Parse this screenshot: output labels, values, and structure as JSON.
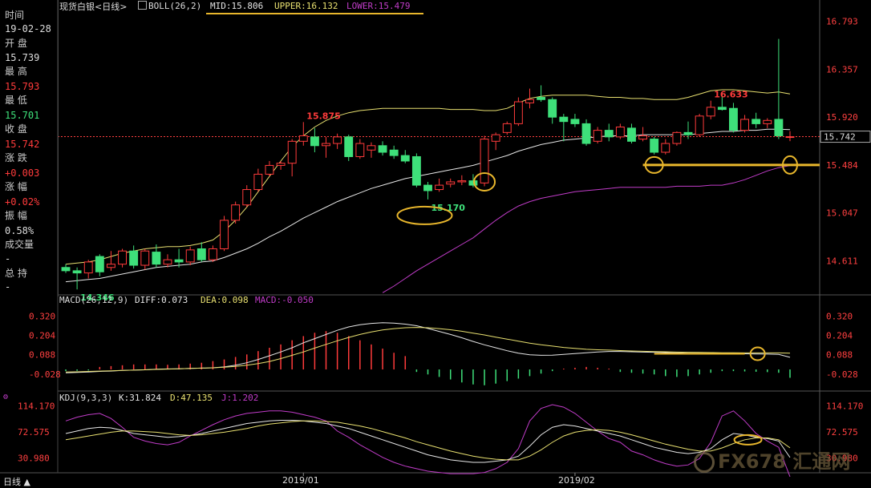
{
  "info_panel": {
    "labels": [
      "时间",
      "开 盘",
      "最 高",
      "最 低",
      "收 盘",
      "涨 跌",
      "涨 幅",
      "振 幅",
      "成交量",
      "总 持"
    ],
    "date": "19-02-28",
    "open": "15.739",
    "high": "15.793",
    "low": "15.701",
    "close": "15.742",
    "change": "+0.003",
    "change_pct": "+0.02%",
    "amplitude": "0.58%",
    "volume": "-",
    "open_interest": "-"
  },
  "main_header": {
    "instrument": "现货白银<日线>",
    "boll_label": "BOLL(26,2)",
    "mid": "MID:15.806",
    "upper": "UPPER:16.132",
    "lower": "LOWER:15.479"
  },
  "macd_header": {
    "label": "MACD(26,12,9)",
    "diff": "DIFF:0.073",
    "dea": "DEA:0.098",
    "macd": "MACD:-0.050"
  },
  "kdj_header": {
    "label": "KDJ(9,3,3)",
    "k": "K:31.824",
    "d": "D:47.135",
    "j": "J:1.202"
  },
  "bottom": {
    "period_button": "日线 ▲",
    "date_labels": [
      "2019/01",
      "2019/02"
    ]
  },
  "watermark": "FX678 汇通网",
  "colors": {
    "up": "#ff3b3b",
    "down": "#3ee07a",
    "mid": "#e6e6e6",
    "upper": "#e8e070",
    "lower": "#c03cc8",
    "annotation": "#e8b62c",
    "axis_text": "#ff4040"
  },
  "chart_data": [
    {
      "type": "candlestick",
      "title": "现货白银<日线> BOLL(26,2)",
      "y_ticks": [
        16.793,
        16.357,
        15.92,
        15.484,
        15.047,
        14.611
      ],
      "ylim": [
        14.3,
        16.9
      ],
      "current_price_label": "15.742",
      "annotations": [
        {
          "text": "15.875",
          "kind": "high",
          "index": 21
        },
        {
          "text": "15.170",
          "kind": "low",
          "index": 32
        },
        {
          "text": "14.346",
          "kind": "low",
          "index": 1
        },
        {
          "text": "16.633",
          "kind": "high",
          "index": 57
        }
      ],
      "horizontal_line": 15.484,
      "candles": [
        {
          "o": 14.55,
          "h": 14.58,
          "l": 14.5,
          "c": 14.52
        },
        {
          "o": 14.52,
          "h": 14.55,
          "l": 14.35,
          "c": 14.5
        },
        {
          "o": 14.5,
          "h": 14.62,
          "l": 14.45,
          "c": 14.6
        },
        {
          "o": 14.65,
          "h": 14.67,
          "l": 14.47,
          "c": 14.51
        },
        {
          "o": 14.55,
          "h": 14.7,
          "l": 14.52,
          "c": 14.58
        },
        {
          "o": 14.58,
          "h": 14.72,
          "l": 14.55,
          "c": 14.7
        },
        {
          "o": 14.7,
          "h": 14.75,
          "l": 14.54,
          "c": 14.57
        },
        {
          "o": 14.57,
          "h": 14.72,
          "l": 14.53,
          "c": 14.7
        },
        {
          "o": 14.69,
          "h": 14.76,
          "l": 14.55,
          "c": 14.58
        },
        {
          "o": 14.58,
          "h": 14.67,
          "l": 14.55,
          "c": 14.62
        },
        {
          "o": 14.62,
          "h": 14.72,
          "l": 14.55,
          "c": 14.6
        },
        {
          "o": 14.6,
          "h": 14.74,
          "l": 14.57,
          "c": 14.71
        },
        {
          "o": 14.72,
          "h": 14.78,
          "l": 14.6,
          "c": 14.62
        },
        {
          "o": 14.62,
          "h": 14.75,
          "l": 14.6,
          "c": 14.72
        },
        {
          "o": 14.72,
          "h": 15.02,
          "l": 14.7,
          "c": 14.98
        },
        {
          "o": 14.98,
          "h": 15.15,
          "l": 14.95,
          "c": 15.12
        },
        {
          "o": 15.12,
          "h": 15.3,
          "l": 15.1,
          "c": 15.26
        },
        {
          "o": 15.26,
          "h": 15.45,
          "l": 15.24,
          "c": 15.4
        },
        {
          "o": 15.4,
          "h": 15.52,
          "l": 15.38,
          "c": 15.48
        },
        {
          "o": 15.48,
          "h": 15.52,
          "l": 15.44,
          "c": 15.5
        },
        {
          "o": 15.5,
          "h": 15.72,
          "l": 15.38,
          "c": 15.7
        },
        {
          "o": 15.7,
          "h": 15.875,
          "l": 15.66,
          "c": 15.75
        },
        {
          "o": 15.74,
          "h": 15.82,
          "l": 15.6,
          "c": 15.66
        },
        {
          "o": 15.66,
          "h": 15.74,
          "l": 15.55,
          "c": 15.68
        },
        {
          "o": 15.68,
          "h": 15.77,
          "l": 15.63,
          "c": 15.74
        },
        {
          "o": 15.74,
          "h": 15.76,
          "l": 15.52,
          "c": 15.56
        },
        {
          "o": 15.56,
          "h": 15.72,
          "l": 15.54,
          "c": 15.68
        },
        {
          "o": 15.62,
          "h": 15.69,
          "l": 15.55,
          "c": 15.66
        },
        {
          "o": 15.66,
          "h": 15.7,
          "l": 15.57,
          "c": 15.6
        },
        {
          "o": 15.62,
          "h": 15.66,
          "l": 15.54,
          "c": 15.57
        },
        {
          "o": 15.57,
          "h": 15.62,
          "l": 15.5,
          "c": 15.52
        },
        {
          "o": 15.56,
          "h": 15.59,
          "l": 15.28,
          "c": 15.3
        },
        {
          "o": 15.3,
          "h": 15.33,
          "l": 15.17,
          "c": 15.25
        },
        {
          "o": 15.26,
          "h": 15.36,
          "l": 15.24,
          "c": 15.3
        },
        {
          "o": 15.31,
          "h": 15.36,
          "l": 15.28,
          "c": 15.33
        },
        {
          "o": 15.33,
          "h": 15.39,
          "l": 15.3,
          "c": 15.34
        },
        {
          "o": 15.34,
          "h": 15.4,
          "l": 15.28,
          "c": 15.3
        },
        {
          "o": 15.32,
          "h": 15.75,
          "l": 15.29,
          "c": 15.72
        },
        {
          "o": 15.7,
          "h": 15.78,
          "l": 15.62,
          "c": 15.76
        },
        {
          "o": 15.78,
          "h": 15.88,
          "l": 15.76,
          "c": 15.86
        },
        {
          "o": 15.86,
          "h": 16.1,
          "l": 15.84,
          "c": 16.06
        },
        {
          "o": 16.05,
          "h": 16.18,
          "l": 16.0,
          "c": 16.08
        },
        {
          "o": 16.1,
          "h": 16.21,
          "l": 16.06,
          "c": 16.08
        },
        {
          "o": 16.08,
          "h": 16.1,
          "l": 15.86,
          "c": 15.92
        },
        {
          "o": 15.92,
          "h": 15.95,
          "l": 15.7,
          "c": 15.88
        },
        {
          "o": 15.9,
          "h": 15.95,
          "l": 15.83,
          "c": 15.86
        },
        {
          "o": 15.86,
          "h": 15.9,
          "l": 15.66,
          "c": 15.68
        },
        {
          "o": 15.7,
          "h": 15.83,
          "l": 15.68,
          "c": 15.8
        },
        {
          "o": 15.8,
          "h": 15.86,
          "l": 15.7,
          "c": 15.74
        },
        {
          "o": 15.74,
          "h": 15.86,
          "l": 15.72,
          "c": 15.83
        },
        {
          "o": 15.82,
          "h": 15.86,
          "l": 15.68,
          "c": 15.7
        },
        {
          "o": 15.72,
          "h": 15.83,
          "l": 15.7,
          "c": 15.75
        },
        {
          "o": 15.72,
          "h": 15.74,
          "l": 15.58,
          "c": 15.6
        },
        {
          "o": 15.6,
          "h": 15.72,
          "l": 15.58,
          "c": 15.68
        },
        {
          "o": 15.68,
          "h": 15.79,
          "l": 15.66,
          "c": 15.78
        },
        {
          "o": 15.78,
          "h": 15.88,
          "l": 15.72,
          "c": 15.76
        },
        {
          "o": 15.76,
          "h": 15.95,
          "l": 15.74,
          "c": 15.93
        },
        {
          "o": 15.93,
          "h": 16.07,
          "l": 15.9,
          "c": 16.01
        },
        {
          "o": 16.01,
          "h": 16.15,
          "l": 15.98,
          "c": 15.99
        },
        {
          "o": 16.0,
          "h": 16.05,
          "l": 15.78,
          "c": 15.8
        },
        {
          "o": 15.8,
          "h": 15.94,
          "l": 15.78,
          "c": 15.9
        },
        {
          "o": 15.9,
          "h": 15.96,
          "l": 15.82,
          "c": 15.86
        },
        {
          "o": 15.86,
          "h": 15.91,
          "l": 15.82,
          "c": 15.89
        },
        {
          "o": 15.9,
          "h": 16.633,
          "l": 15.72,
          "c": 15.75
        },
        {
          "o": 15.739,
          "h": 15.793,
          "l": 15.701,
          "c": 15.742
        }
      ],
      "boll_mid": [
        14.42,
        14.43,
        14.44,
        14.45,
        14.47,
        14.49,
        14.51,
        14.53,
        14.55,
        14.56,
        14.57,
        14.58,
        14.6,
        14.61,
        14.64,
        14.68,
        14.72,
        14.77,
        14.83,
        14.88,
        14.94,
        15.0,
        15.05,
        15.1,
        15.15,
        15.19,
        15.23,
        15.27,
        15.3,
        15.33,
        15.36,
        15.38,
        15.4,
        15.42,
        15.44,
        15.46,
        15.48,
        15.51,
        15.54,
        15.57,
        15.61,
        15.64,
        15.67,
        15.69,
        15.71,
        15.72,
        15.73,
        15.74,
        15.75,
        15.75,
        15.75,
        15.76,
        15.76,
        15.76,
        15.76,
        15.76,
        15.77,
        15.78,
        15.79,
        15.79,
        15.8,
        15.8,
        15.81,
        15.81,
        15.806
      ],
      "boll_upper": [
        14.58,
        14.59,
        14.6,
        14.62,
        14.65,
        14.68,
        14.7,
        14.72,
        14.73,
        14.74,
        14.74,
        14.75,
        14.77,
        14.8,
        14.88,
        14.98,
        15.1,
        15.24,
        15.38,
        15.52,
        15.65,
        15.75,
        15.83,
        15.89,
        15.93,
        15.96,
        15.98,
        15.99,
        16.0,
        16.0,
        16.0,
        16.0,
        16.0,
        16.0,
        15.99,
        15.99,
        15.99,
        15.98,
        15.98,
        16.0,
        16.05,
        16.09,
        16.11,
        16.12,
        16.12,
        16.12,
        16.12,
        16.11,
        16.1,
        16.1,
        16.09,
        16.09,
        16.08,
        16.08,
        16.08,
        16.1,
        16.13,
        16.16,
        16.17,
        16.17,
        16.16,
        16.15,
        16.14,
        16.15,
        16.132
      ],
      "boll_lower": [
        null,
        null,
        null,
        null,
        null,
        null,
        null,
        null,
        null,
        null,
        null,
        null,
        null,
        null,
        null,
        null,
        null,
        null,
        null,
        null,
        null,
        null,
        null,
        null,
        null,
        null,
        null,
        null,
        14.32,
        14.38,
        14.45,
        14.52,
        14.58,
        14.64,
        14.7,
        14.76,
        14.82,
        14.9,
        14.98,
        15.05,
        15.11,
        15.15,
        15.18,
        15.2,
        15.22,
        15.24,
        15.25,
        15.26,
        15.27,
        15.28,
        15.28,
        15.28,
        15.28,
        15.28,
        15.29,
        15.29,
        15.29,
        15.3,
        15.3,
        15.32,
        15.35,
        15.39,
        15.43,
        15.46,
        15.479
      ]
    },
    {
      "type": "bar+line",
      "title": "MACD(26,12,9)",
      "y_ticks": [
        0.32,
        0.204,
        0.088,
        -0.028
      ],
      "ylim": [
        -0.12,
        0.38
      ],
      "diff": [
        -0.02,
        -0.018,
        -0.015,
        -0.012,
        -0.01,
        -0.006,
        -0.004,
        -0.002,
        0.001,
        0.003,
        0.004,
        0.006,
        0.008,
        0.01,
        0.015,
        0.025,
        0.04,
        0.06,
        0.082,
        0.105,
        0.13,
        0.16,
        0.185,
        0.21,
        0.235,
        0.255,
        0.268,
        0.276,
        0.28,
        0.278,
        0.272,
        0.262,
        0.246,
        0.228,
        0.21,
        0.19,
        0.168,
        0.148,
        0.13,
        0.112,
        0.098,
        0.088,
        0.085,
        0.086,
        0.09,
        0.095,
        0.1,
        0.105,
        0.108,
        0.108,
        0.106,
        0.104,
        0.103,
        0.101,
        0.099,
        0.098,
        0.098,
        0.097,
        0.096,
        0.095,
        0.094,
        0.093,
        0.092,
        0.09,
        0.073
      ],
      "dea": [
        -0.015,
        -0.014,
        -0.012,
        -0.01,
        -0.008,
        -0.006,
        -0.004,
        -0.002,
        0.0,
        0.002,
        0.004,
        0.006,
        0.008,
        0.01,
        0.013,
        0.018,
        0.025,
        0.035,
        0.048,
        0.065,
        0.085,
        0.105,
        0.128,
        0.15,
        0.172,
        0.192,
        0.21,
        0.225,
        0.237,
        0.245,
        0.25,
        0.252,
        0.25,
        0.245,
        0.238,
        0.229,
        0.218,
        0.207,
        0.194,
        0.182,
        0.17,
        0.158,
        0.148,
        0.14,
        0.132,
        0.126,
        0.121,
        0.118,
        0.116,
        0.113,
        0.111,
        0.109,
        0.107,
        0.106,
        0.104,
        0.103,
        0.102,
        0.101,
        0.1,
        0.1,
        0.099,
        0.099,
        0.099,
        0.099,
        0.098
      ],
      "macd": [
        -0.01,
        -0.008,
        -0.006,
        0.015,
        0.02,
        0.025,
        0.03,
        0.03,
        0.03,
        0.028,
        0.03,
        0.035,
        0.04,
        0.05,
        0.06,
        0.075,
        0.09,
        0.11,
        0.13,
        0.15,
        0.175,
        0.2,
        0.22,
        0.23,
        0.22,
        0.2,
        0.175,
        0.15,
        0.125,
        0.1,
        0.08,
        -0.015,
        -0.03,
        -0.045,
        -0.06,
        -0.078,
        -0.09,
        -0.095,
        -0.085,
        -0.07,
        -0.055,
        -0.04,
        -0.025,
        -0.01,
        0.005,
        0.01,
        0.015,
        0.01,
        0.005,
        -0.015,
        -0.02,
        -0.025,
        -0.03,
        -0.04,
        -0.045,
        -0.04,
        -0.03,
        -0.02,
        -0.01,
        -0.01,
        -0.012,
        -0.014,
        -0.016,
        -0.02,
        -0.05
      ]
    },
    {
      "type": "line",
      "title": "KDJ(9,3,3)",
      "y_ticks": [
        114.17,
        72.575,
        30.98
      ],
      "ylim": [
        10,
        130
      ],
      "k": [
        70,
        74,
        78,
        80,
        79,
        75,
        70,
        68,
        66,
        64,
        65,
        67,
        70,
        74,
        78,
        82,
        86,
        88,
        90,
        91,
        91,
        90,
        88,
        86,
        82,
        78,
        72,
        66,
        60,
        54,
        48,
        42,
        36,
        32,
        28,
        26,
        24,
        24,
        26,
        28,
        34,
        50,
        68,
        80,
        84,
        82,
        78,
        74,
        70,
        66,
        60,
        54,
        48,
        44,
        40,
        38,
        40,
        46,
        60,
        70,
        68,
        64,
        62,
        58,
        31.824
      ],
      "d": [
        60,
        63,
        66,
        69,
        72,
        74,
        74,
        73,
        72,
        70,
        68,
        67,
        68,
        70,
        72,
        75,
        78,
        82,
        85,
        87,
        89,
        90,
        90,
        89,
        88,
        85,
        82,
        78,
        73,
        68,
        63,
        57,
        52,
        47,
        42,
        38,
        34,
        31,
        29,
        28,
        28,
        34,
        44,
        56,
        66,
        72,
        75,
        76,
        75,
        72,
        68,
        63,
        58,
        53,
        49,
        45,
        42,
        42,
        47,
        54,
        60,
        63,
        63,
        60,
        47.135
      ],
      "j": [
        90,
        96,
        100,
        102,
        94,
        80,
        64,
        58,
        54,
        52,
        56,
        66,
        75,
        84,
        92,
        98,
        102,
        104,
        106,
        106,
        104,
        100,
        96,
        90,
        74,
        64,
        52,
        42,
        32,
        24,
        18,
        14,
        10,
        8,
        6,
        6,
        6,
        8,
        14,
        24,
        46,
        90,
        110,
        116,
        112,
        102,
        88,
        74,
        62,
        56,
        42,
        36,
        28,
        22,
        18,
        20,
        30,
        56,
        98,
        106,
        90,
        70,
        58,
        48,
        1.202
      ]
    }
  ]
}
